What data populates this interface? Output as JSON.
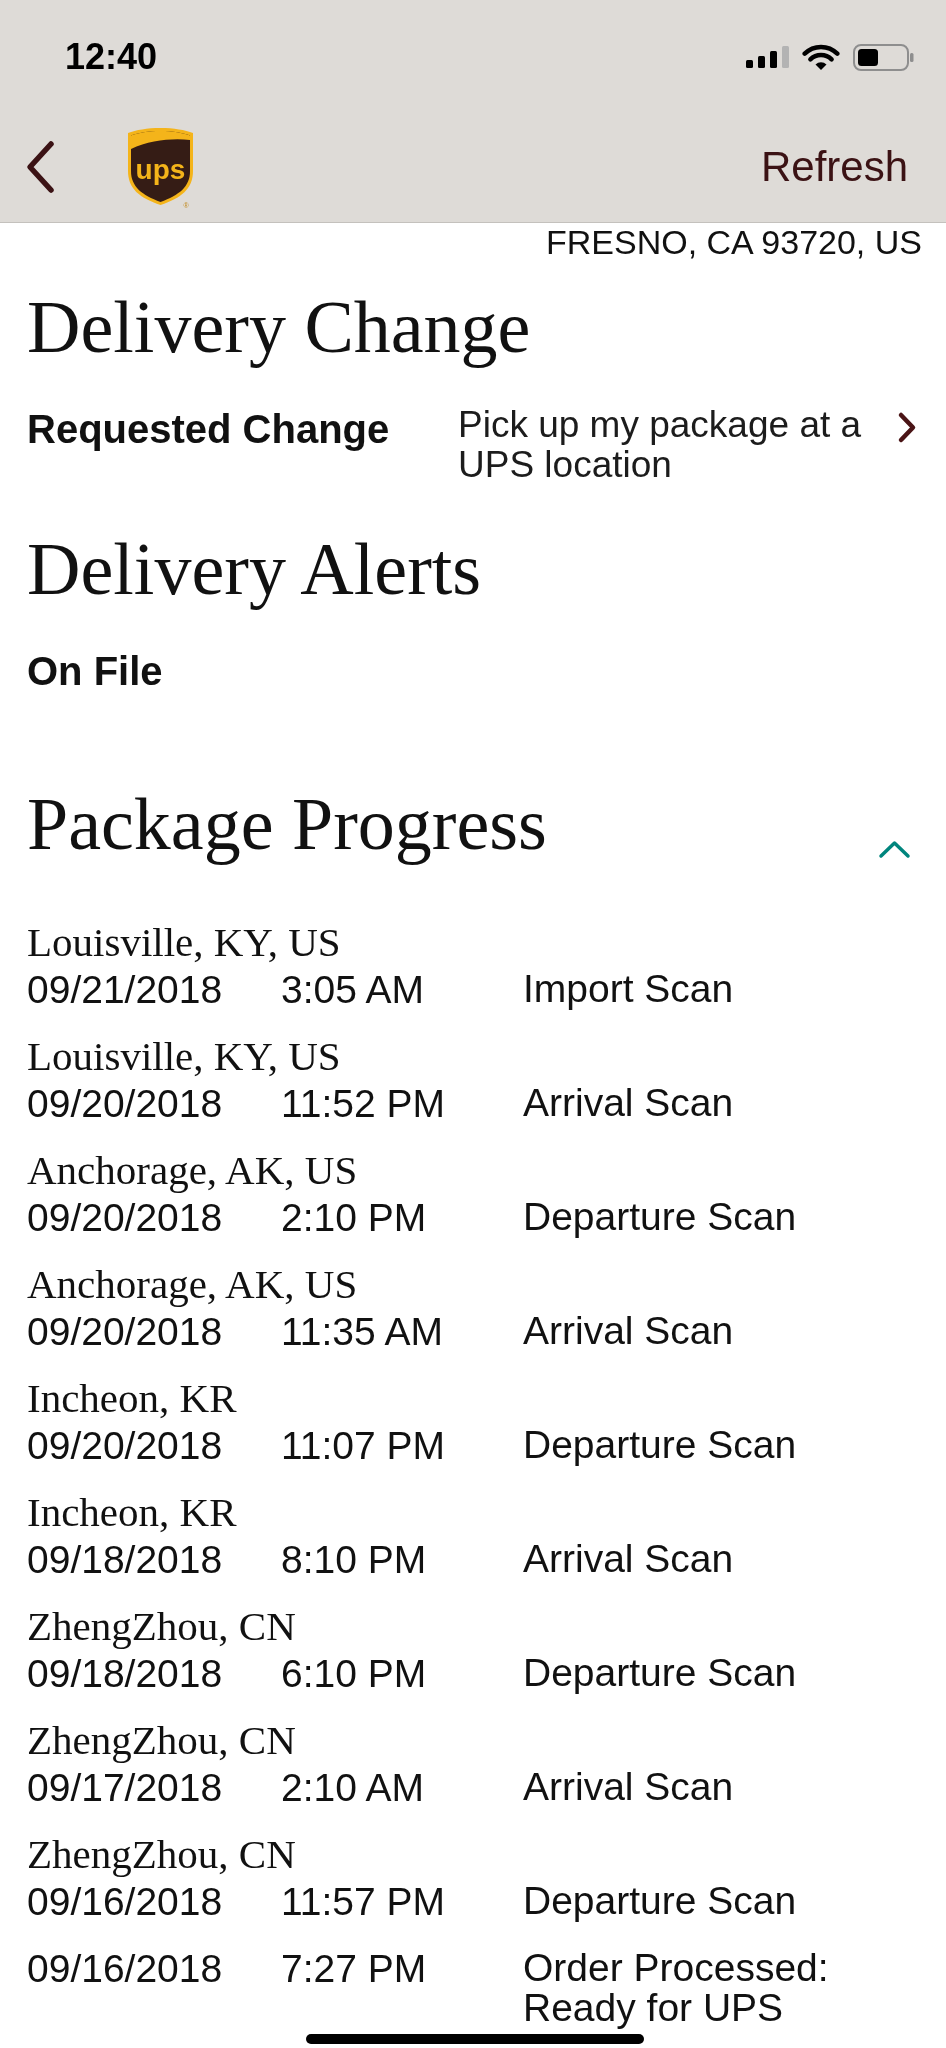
{
  "status_bar": {
    "time": "12:40"
  },
  "nav_bar": {
    "logo": {
      "text": "ups",
      "mark": "®"
    },
    "action": "Refresh"
  },
  "address_tail": "FRESNO, CA 93720, US",
  "delivery_change": {
    "title": "Delivery Change",
    "label": "Requested Change",
    "value": "Pick up my package at a UPS location"
  },
  "delivery_alerts": {
    "title": "Delivery Alerts",
    "status": "On File"
  },
  "package_progress": {
    "title": "Package Progress",
    "expanded": true,
    "events": [
      {
        "location": "Louisville, KY, US",
        "date": "09/21/2018",
        "time": "3:05 AM",
        "activity": "Import Scan"
      },
      {
        "location": "Louisville, KY, US",
        "date": "09/20/2018",
        "time": "11:52 PM",
        "activity": "Arrival Scan"
      },
      {
        "location": "Anchorage, AK, US",
        "date": "09/20/2018",
        "time": "2:10 PM",
        "activity": "Departure Scan"
      },
      {
        "location": "Anchorage, AK, US",
        "date": "09/20/2018",
        "time": "11:35 AM",
        "activity": "Arrival Scan"
      },
      {
        "location": "Incheon, KR",
        "date": "09/20/2018",
        "time": "11:07 PM",
        "activity": "Departure Scan"
      },
      {
        "location": "Incheon, KR",
        "date": "09/18/2018",
        "time": "8:10 PM",
        "activity": "Arrival Scan"
      },
      {
        "location": "ZhengZhou, CN",
        "date": "09/18/2018",
        "time": "6:10 PM",
        "activity": "Departure Scan"
      },
      {
        "location": "ZhengZhou, CN",
        "date": "09/17/2018",
        "time": "2:10 AM",
        "activity": "Arrival Scan"
      },
      {
        "location": "ZhengZhou, CN",
        "date": "09/16/2018",
        "time": "11:57 PM",
        "activity": "Departure Scan"
      },
      {
        "date": "09/16/2018",
        "time": "7:27 PM",
        "activity": "Order Processed: Ready for UPS"
      }
    ]
  }
}
